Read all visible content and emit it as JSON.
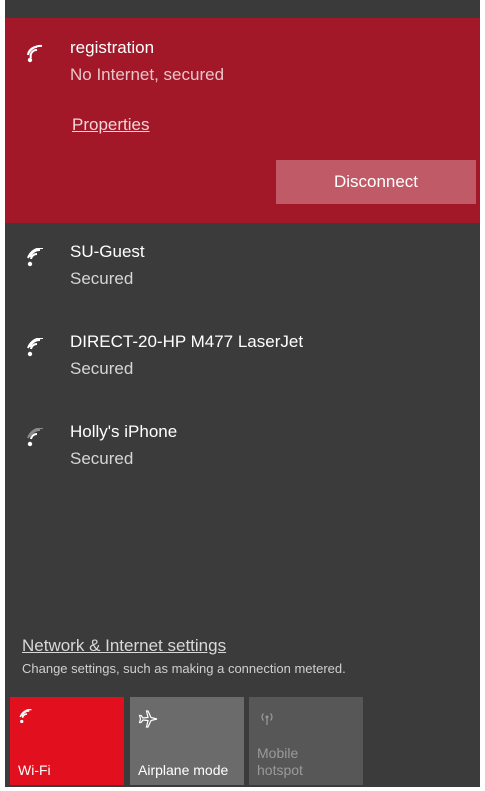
{
  "connected_network": {
    "name": "registration",
    "status": "No Internet, secured",
    "properties_label": "Properties",
    "disconnect_label": "Disconnect"
  },
  "networks": [
    {
      "name": "SU-Guest",
      "status": "Secured",
      "icon": "wifi-strong-icon"
    },
    {
      "name": "DIRECT-20-HP M477 LaserJet",
      "status": "Secured",
      "icon": "wifi-strong-icon"
    },
    {
      "name": "Holly's iPhone",
      "status": "Secured",
      "icon": "wifi-weak-icon"
    }
  ],
  "settings": {
    "link_label": "Network & Internet settings",
    "description": "Change settings, such as making a connection metered."
  },
  "quick_actions": [
    {
      "label": "Wi-Fi",
      "state": "on",
      "icon": "wifi-icon"
    },
    {
      "label": "Airplane mode",
      "state": "off",
      "icon": "airplane-icon"
    },
    {
      "label": "Mobile\nhotspot",
      "state": "disabled",
      "icon": "hotspot-icon"
    }
  ],
  "colors": {
    "accent": "#e2101e",
    "connected_background": "#a21829",
    "panel_background": "#3b3b3b"
  }
}
